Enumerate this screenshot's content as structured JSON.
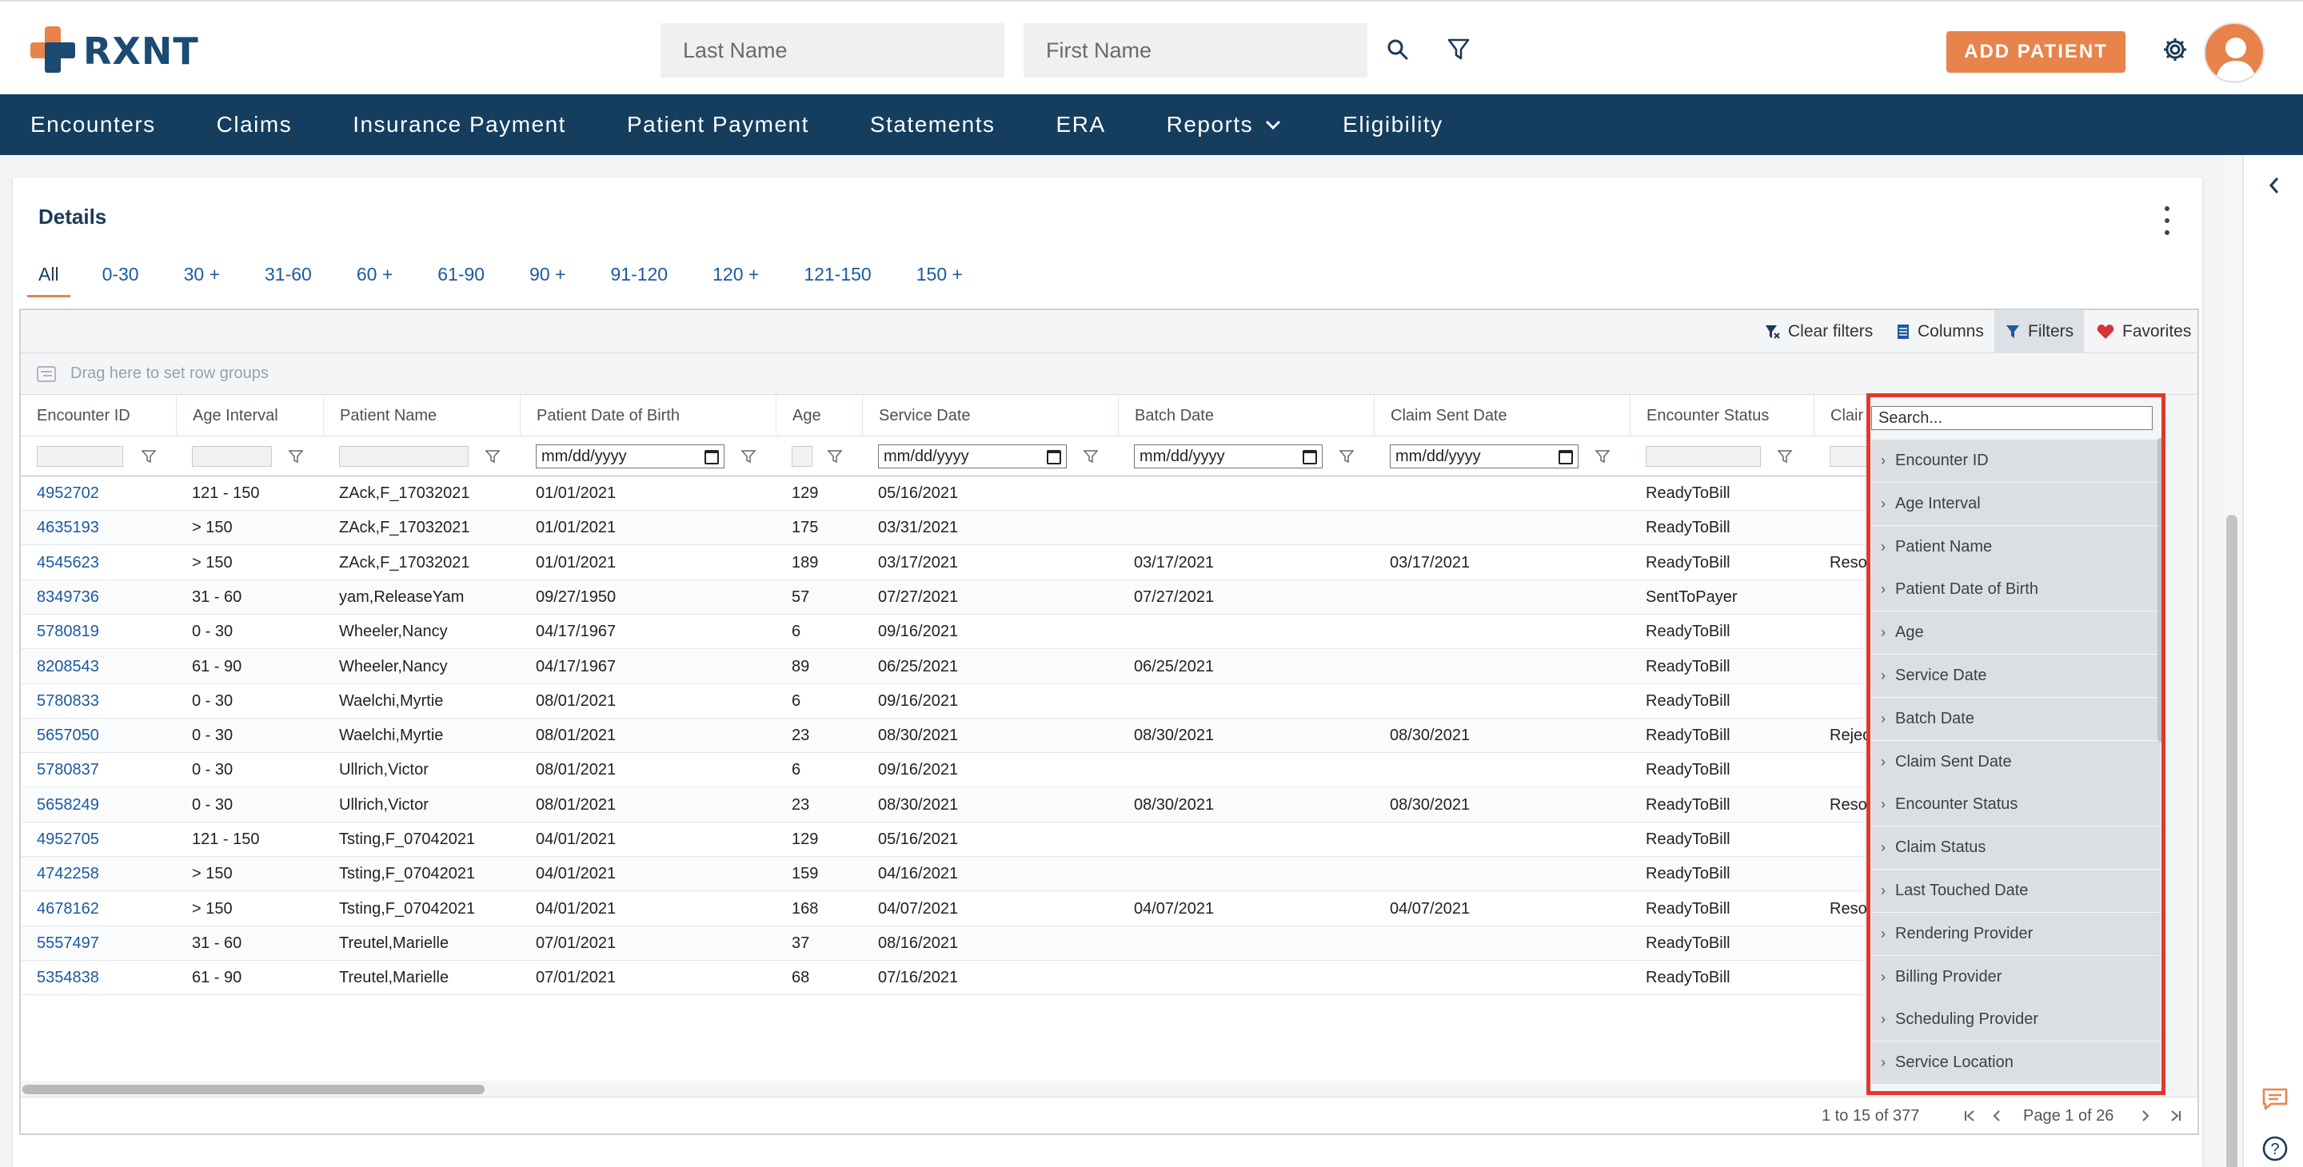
{
  "header": {
    "logo_text": "RXNT",
    "last_name_placeholder": "Last Name",
    "first_name_placeholder": "First Name",
    "add_patient_label": "ADD PATIENT",
    "icons": [
      "search-icon",
      "filter-icon",
      "gear-icon",
      "avatar"
    ]
  },
  "nav": {
    "items": [
      {
        "label": "Encounters"
      },
      {
        "label": "Claims"
      },
      {
        "label": "Insurance Payment"
      },
      {
        "label": "Patient Payment"
      },
      {
        "label": "Statements"
      },
      {
        "label": "ERA"
      },
      {
        "label": "Reports"
      },
      {
        "label": "Eligibility"
      }
    ]
  },
  "details": {
    "title": "Details",
    "tabs": [
      "All",
      "0-30",
      "30 +",
      "31-60",
      "60 +",
      "61-90",
      "90 +",
      "91-120",
      "120 +",
      "121-150",
      "150 +"
    ],
    "active_tab": "All"
  },
  "toolbar": {
    "clear_filters": "Clear filters",
    "columns": "Columns",
    "filters": "Filters",
    "favorites": "Favorites"
  },
  "group_bar": {
    "placeholder": "Drag here to set row groups"
  },
  "table": {
    "columns": [
      "Encounter ID",
      "Age Interval",
      "Patient Name",
      "Patient Date of Birth",
      "Age",
      "Service Date",
      "Batch Date",
      "Claim Sent Date",
      "Encounter Status",
      "Clair"
    ],
    "date_placeholder": "mm/dd/yyyy",
    "rows": [
      [
        "4952702",
        "121 - 150",
        "ZAck,F_17032021",
        "01/01/2021",
        "129",
        "05/16/2021",
        "",
        "",
        "ReadyToBill",
        ""
      ],
      [
        "4635193",
        "> 150",
        "ZAck,F_17032021",
        "01/01/2021",
        "175",
        "03/31/2021",
        "",
        "",
        "ReadyToBill",
        ""
      ],
      [
        "4545623",
        "> 150",
        "ZAck,F_17032021",
        "01/01/2021",
        "189",
        "03/17/2021",
        "03/17/2021",
        "03/17/2021",
        "ReadyToBill",
        "Reso"
      ],
      [
        "8349736",
        "31 - 60",
        "yam,ReleaseYam",
        "09/27/1950",
        "57",
        "07/27/2021",
        "07/27/2021",
        "",
        "SentToPayer",
        ""
      ],
      [
        "5780819",
        "0 - 30",
        "Wheeler,Nancy",
        "04/17/1967",
        "6",
        "09/16/2021",
        "",
        "",
        "ReadyToBill",
        ""
      ],
      [
        "8208543",
        "61 - 90",
        "Wheeler,Nancy",
        "04/17/1967",
        "89",
        "06/25/2021",
        "06/25/2021",
        "",
        "ReadyToBill",
        ""
      ],
      [
        "5780833",
        "0 - 30",
        "Waelchi,Myrtie",
        "08/01/2021",
        "6",
        "09/16/2021",
        "",
        "",
        "ReadyToBill",
        ""
      ],
      [
        "5657050",
        "0 - 30",
        "Waelchi,Myrtie",
        "08/01/2021",
        "23",
        "08/30/2021",
        "08/30/2021",
        "08/30/2021",
        "ReadyToBill",
        "Rejec"
      ],
      [
        "5780837",
        "0 - 30",
        "Ullrich,Victor",
        "08/01/2021",
        "6",
        "09/16/2021",
        "",
        "",
        "ReadyToBill",
        ""
      ],
      [
        "5658249",
        "0 - 30",
        "Ullrich,Victor",
        "08/01/2021",
        "23",
        "08/30/2021",
        "08/30/2021",
        "08/30/2021",
        "ReadyToBill",
        "Reso"
      ],
      [
        "4952705",
        "121 - 150",
        "Tsting,F_07042021",
        "04/01/2021",
        "129",
        "05/16/2021",
        "",
        "",
        "ReadyToBill",
        ""
      ],
      [
        "4742258",
        "> 150",
        "Tsting,F_07042021",
        "04/01/2021",
        "159",
        "04/16/2021",
        "",
        "",
        "ReadyToBill",
        ""
      ],
      [
        "4678162",
        "> 150",
        "Tsting,F_07042021",
        "04/01/2021",
        "168",
        "04/07/2021",
        "04/07/2021",
        "04/07/2021",
        "ReadyToBill",
        "Reso"
      ],
      [
        "5557497",
        "31 - 60",
        "Treutel,Marielle",
        "07/01/2021",
        "37",
        "08/16/2021",
        "",
        "",
        "ReadyToBill",
        ""
      ],
      [
        "5354838",
        "61 - 90",
        "Treutel,Marielle",
        "07/01/2021",
        "68",
        "07/16/2021",
        "",
        "",
        "ReadyToBill",
        ""
      ]
    ]
  },
  "filter_panel": {
    "search_placeholder": "Search...",
    "items": [
      "Encounter ID",
      "Age Interval",
      "Patient Name",
      "Patient Date of Birth",
      "Age",
      "Service Date",
      "Batch Date",
      "Claim Sent Date",
      "Encounter Status",
      "Claim Status",
      "Last Touched Date",
      "Rendering Provider",
      "Billing Provider",
      "Scheduling Provider",
      "Service Location"
    ]
  },
  "footer": {
    "range_text": "1 to 15 of 377",
    "page_text": "Page 1 of 26"
  },
  "colors": {
    "nav_bg": "#153d5e",
    "accent": "#e8834c",
    "link": "#1b5aa0",
    "highlight_outline": "#e0392c"
  }
}
